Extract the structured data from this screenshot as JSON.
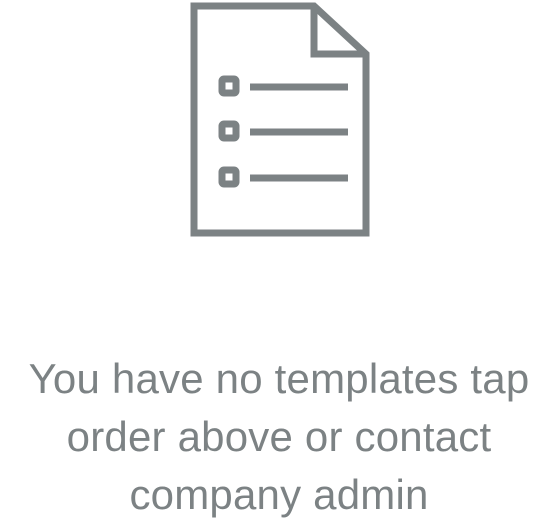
{
  "empty_state": {
    "icon": "document-checklist-icon",
    "message_lines": [
      "You have no templates tap",
      "order above or contact",
      "company admin"
    ],
    "color": "#7c8284"
  }
}
